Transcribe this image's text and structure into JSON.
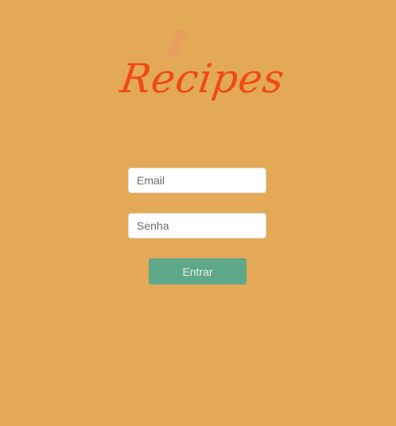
{
  "logo": {
    "text": "Recipes"
  },
  "form": {
    "email_placeholder": "Email",
    "password_placeholder": "Senha",
    "submit_label": "Entrar"
  },
  "colors": {
    "background": "#e3a957",
    "logo": "#f04a12",
    "button": "#5fa88a"
  }
}
